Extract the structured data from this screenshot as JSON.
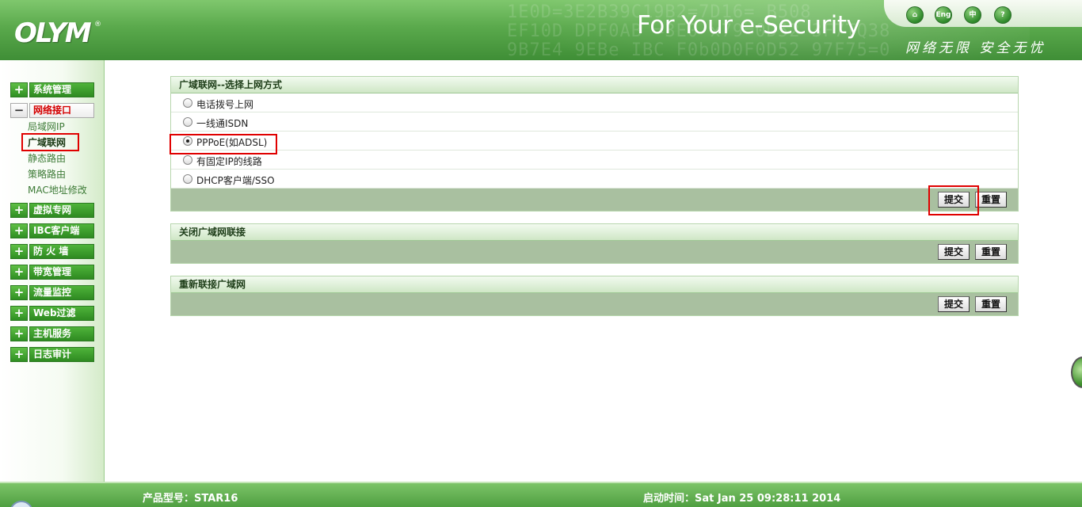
{
  "header": {
    "logo": "OLYM",
    "logo_mark": "®",
    "slogan": "For Your e-Security",
    "slogan_cn": "网络无限 安全无忧",
    "bg_text": "1E0D=3E2B39C19B2=7D16= B508\nEF10D DPF0AB =3E0 x79=0D52 3F7TQ38\n9B7E4 9EBe IBC F0b0D0F0D52 97F75=0",
    "icons": [
      {
        "name": "home-icon",
        "glyph": "⌂"
      },
      {
        "name": "english-icon",
        "glyph": "Eng"
      },
      {
        "name": "chinese-icon",
        "glyph": "中"
      },
      {
        "name": "help-icon",
        "glyph": "?"
      }
    ]
  },
  "sidebar": {
    "menus": [
      {
        "label": "系统管理",
        "toggle": "+"
      },
      {
        "label": "网络接口",
        "toggle": "−"
      },
      {
        "label": "虚拟专网",
        "toggle": "+"
      },
      {
        "label": "IBC客户端",
        "toggle": "+"
      },
      {
        "label": "防 火 墙",
        "toggle": "+"
      },
      {
        "label": "带宽管理",
        "toggle": "+"
      },
      {
        "label": "流量监控",
        "toggle": "+"
      },
      {
        "label": "Web过滤",
        "toggle": "+"
      },
      {
        "label": "主机服务",
        "toggle": "+"
      },
      {
        "label": "日志审计",
        "toggle": "+"
      }
    ],
    "subitems": [
      "局域网IP",
      "广域联网",
      "静态路由",
      "策略路由",
      "MAC地址修改"
    ]
  },
  "wan_mode": {
    "title": "广域联网--选择上网方式",
    "options": [
      {
        "label": "电话拨号上网",
        "checked": false
      },
      {
        "label": "一线通ISDN",
        "checked": false
      },
      {
        "label": "PPPoE(如ADSL)",
        "checked": true
      },
      {
        "label": "有固定IP的线路",
        "checked": false
      },
      {
        "label": "DHCP客户端/SSO",
        "checked": false
      }
    ],
    "submit": "提交",
    "reset": "重置"
  },
  "close_wan": {
    "title": "关闭广域网联接",
    "submit": "提交",
    "reset": "重置"
  },
  "reconnect_wan": {
    "title": "重新联接广域网",
    "submit": "提交",
    "reset": "重置"
  },
  "footer": {
    "model": "产品型号：STAR16",
    "boot_time": "启动时间：Sat Jan 25 09:28:11 2014"
  },
  "colors": {
    "brand_green": "#3f8e36",
    "highlight_red": "#e00000",
    "button_bar": "#a9c0a0"
  }
}
